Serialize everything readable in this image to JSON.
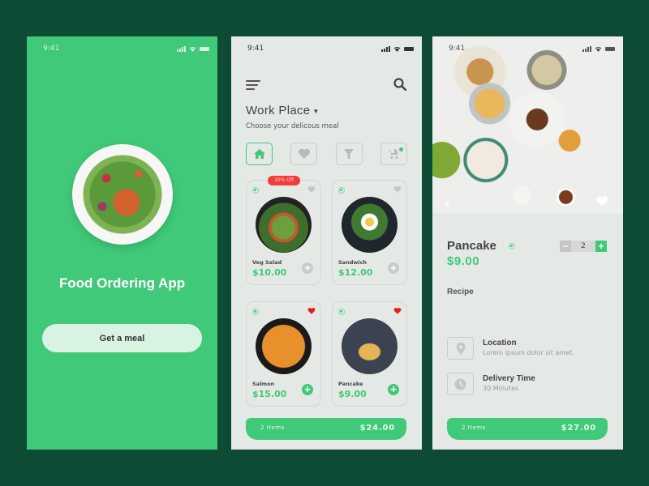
{
  "theme": {
    "background": "#0e4b34",
    "accent": "#40c979",
    "surface": "#e5e9e5",
    "discount": "#f23c3c",
    "favorite": "#e81d1d"
  },
  "splash": {
    "status": {
      "time": "9:41"
    },
    "title": "Food Ordering App",
    "cta_label": "Get a meal",
    "hero_image": "salmon-salad-plate"
  },
  "menu": {
    "status": {
      "time": "9:41"
    },
    "location": "Work Place",
    "subtitle": "Choose your delicous meal",
    "categories": [
      {
        "icon": "home-icon",
        "active": true
      },
      {
        "icon": "heart-icon",
        "active": false
      },
      {
        "icon": "filter-icon",
        "active": false
      },
      {
        "icon": "stroller-icon",
        "active": false,
        "notification": true
      }
    ],
    "items": [
      {
        "name": "Veg Salad",
        "price": "$10.00",
        "badge": "10% Off",
        "favorite": false,
        "in_cart": false,
        "veg": true
      },
      {
        "name": "Sandwich",
        "price": "$12.00",
        "badge": null,
        "favorite": false,
        "in_cart": false,
        "veg": true
      },
      {
        "name": "Salmon",
        "price": "$15.00",
        "badge": null,
        "favorite": true,
        "in_cart": true,
        "veg": true
      },
      {
        "name": "Pancake",
        "price": "$9.00",
        "badge": null,
        "favorite": true,
        "in_cart": true,
        "veg": true
      }
    ],
    "cart": {
      "items_label": "2 Items",
      "total": "$24.00"
    }
  },
  "detail": {
    "status": {
      "time": "9:41"
    },
    "hero_image": "breakfast-table",
    "name": "Pancake",
    "price": "$9.00",
    "quantity": "2",
    "minus_label": "−",
    "plus_label": "+",
    "recipe_label": "Recipe",
    "info": [
      {
        "icon": "location-pin-icon",
        "title": "Location",
        "subtitle": "Lorem ipsum dolor sit amet,"
      },
      {
        "icon": "clock-icon",
        "title": "Delivery Time",
        "subtitle": "30 Minutes"
      }
    ],
    "cart": {
      "items_label": "2 Items",
      "total": "$27.00"
    }
  }
}
